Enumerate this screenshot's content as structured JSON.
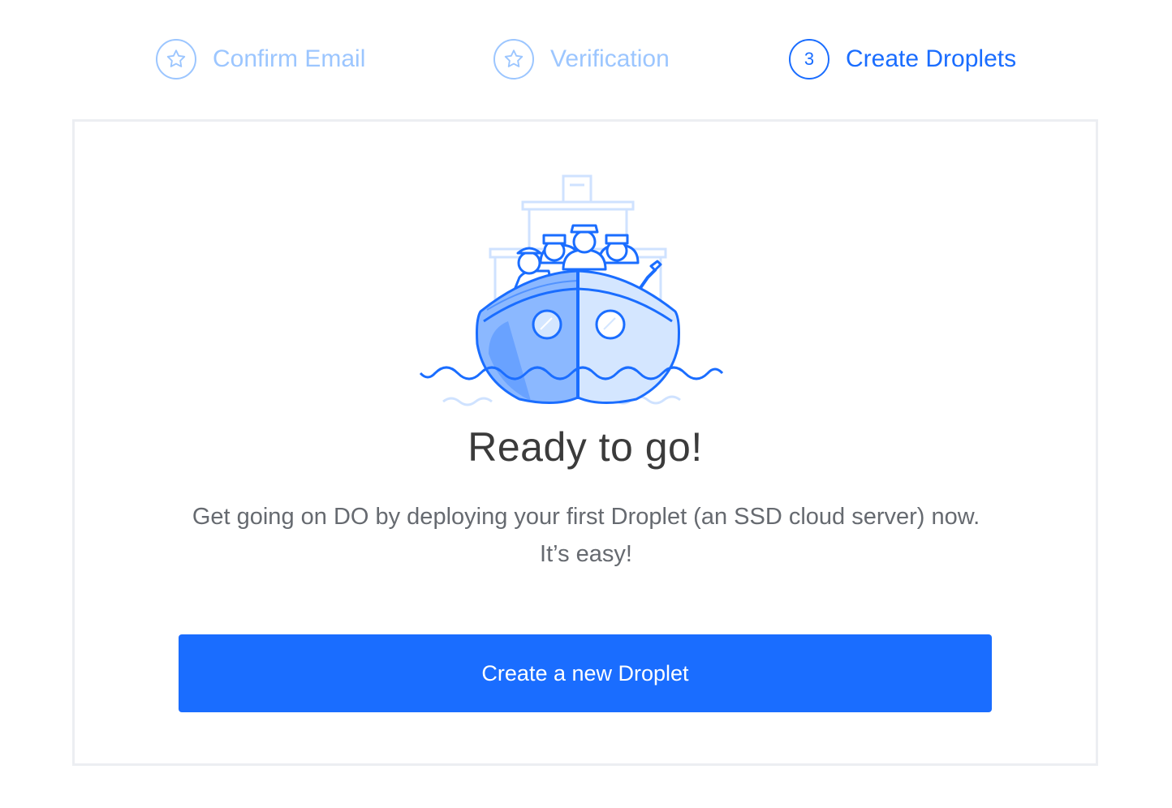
{
  "steps": [
    {
      "label": "Confirm Email",
      "icon": "star-icon",
      "state": "completed"
    },
    {
      "label": "Verification",
      "icon": "star-icon",
      "state": "completed"
    },
    {
      "label": "Create Droplets",
      "number": "3",
      "state": "active"
    }
  ],
  "card": {
    "title": "Ready to go!",
    "description": "Get going on DO by deploying your first Droplet (an SSD cloud server) now. It’s easy!",
    "button_label": "Create a new Droplet"
  },
  "colors": {
    "accent": "#1a6dff",
    "completed_step": "#9cc6ff",
    "title_text": "#3b3b3b",
    "body_text": "#666a70"
  }
}
